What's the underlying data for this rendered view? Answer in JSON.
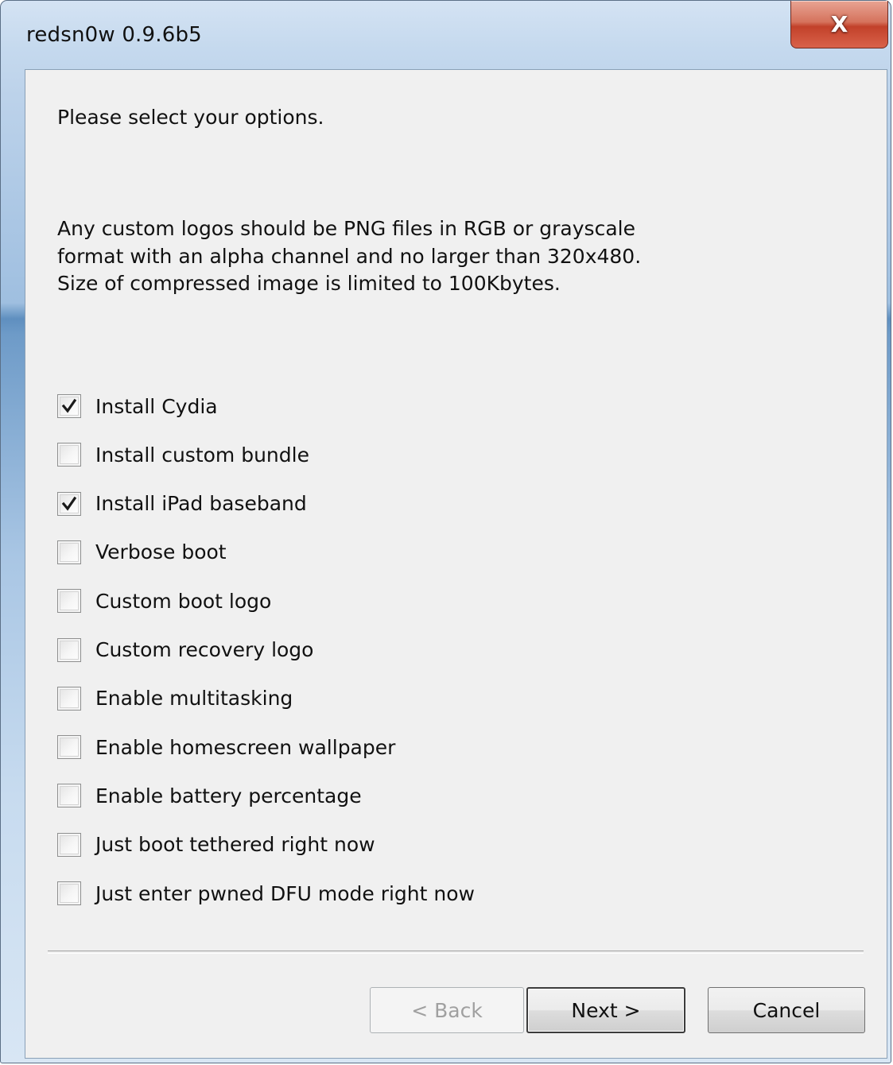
{
  "window": {
    "title": "redsn0w 0.9.6b5",
    "close_glyph": "X"
  },
  "content": {
    "heading": "Please select your options.",
    "info_lines": [
      "Any custom logos should be PNG files in RGB or grayscale",
      "format with an alpha channel and no larger than 320x480.",
      "Size of compressed image is limited to 100Kbytes."
    ]
  },
  "options": [
    {
      "label": "Install Cydia",
      "checked": true
    },
    {
      "label": "Install custom bundle",
      "checked": false
    },
    {
      "label": "Install iPad baseband",
      "checked": true
    },
    {
      "label": "Verbose boot",
      "checked": false
    },
    {
      "label": "Custom boot logo",
      "checked": false
    },
    {
      "label": "Custom recovery logo",
      "checked": false
    },
    {
      "label": "Enable multitasking",
      "checked": false
    },
    {
      "label": "Enable homescreen wallpaper",
      "checked": false
    },
    {
      "label": "Enable battery percentage",
      "checked": false
    },
    {
      "label": "Just boot tethered right now",
      "checked": false
    },
    {
      "label": "Just enter pwned DFU mode right now",
      "checked": false
    }
  ],
  "buttons": {
    "back": {
      "label": "< Back",
      "enabled": false
    },
    "next": {
      "label": "Next >",
      "enabled": true
    },
    "cancel": {
      "label": "Cancel",
      "enabled": true
    }
  },
  "colors": {
    "client_background": "#f0f0f0",
    "close_button": "#c7432c",
    "disabled_text": "#a0a0a0"
  },
  "icons": {
    "close": "close-icon",
    "check": "checkmark-icon"
  }
}
